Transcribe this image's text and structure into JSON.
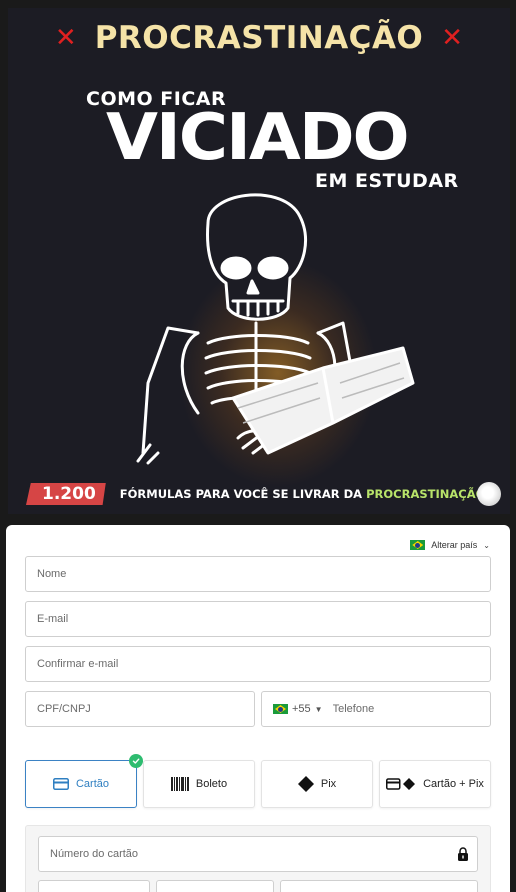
{
  "banner": {
    "brand_title": "PROCRASTINAÇÃO",
    "x_mark": "✕",
    "headline_small": "COMO FICAR",
    "headline_big": "VICIADO",
    "headline_tail": "EM ESTUDAR",
    "count_badge": "1.200",
    "footer_text": "FÓRMULAS PARA VOCÊ SE LIVRAR DA ",
    "footer_accent": "PROCRASTINAÇÃO",
    "colors": {
      "background": "#1c1c24",
      "brand": "#f5e3a8",
      "x_mark": "#e02020",
      "badge": "#d64545",
      "accent": "#b8e36a"
    }
  },
  "form": {
    "country_switch_label": "Alterar país",
    "fields": {
      "name_placeholder": "Nome",
      "email_placeholder": "E-mail",
      "confirm_email_placeholder": "Confirmar e-mail",
      "document_placeholder": "CPF/CNPJ",
      "phone_dial_code": "+55",
      "phone_placeholder": "Telefone"
    },
    "payment_methods": [
      {
        "label": "Cartão",
        "icon": "credit-card-icon",
        "selected": true
      },
      {
        "label": "Boleto",
        "icon": "barcode-icon",
        "selected": false
      },
      {
        "label": "Pix",
        "icon": "pix-icon",
        "selected": false
      },
      {
        "label": "Cartão + Pix",
        "icon": "card-pix-icon",
        "selected": false
      }
    ],
    "card_number_placeholder": "Número do cartão",
    "colors": {
      "selected": "#3b82c4",
      "check": "#2ebc70"
    }
  }
}
